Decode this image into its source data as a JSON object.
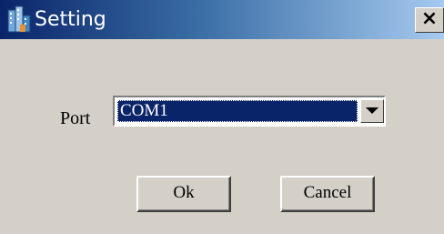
{
  "window": {
    "title": "Setting",
    "close_label": "×",
    "app_icon": "buildings-icon"
  },
  "form": {
    "port_label": "Port",
    "port_value": "COM1"
  },
  "buttons": {
    "ok_label": "Ok",
    "cancel_label": "Cancel"
  },
  "colors": {
    "selection_background": "#0a246a",
    "dialog_background": "#d4d0c8"
  }
}
